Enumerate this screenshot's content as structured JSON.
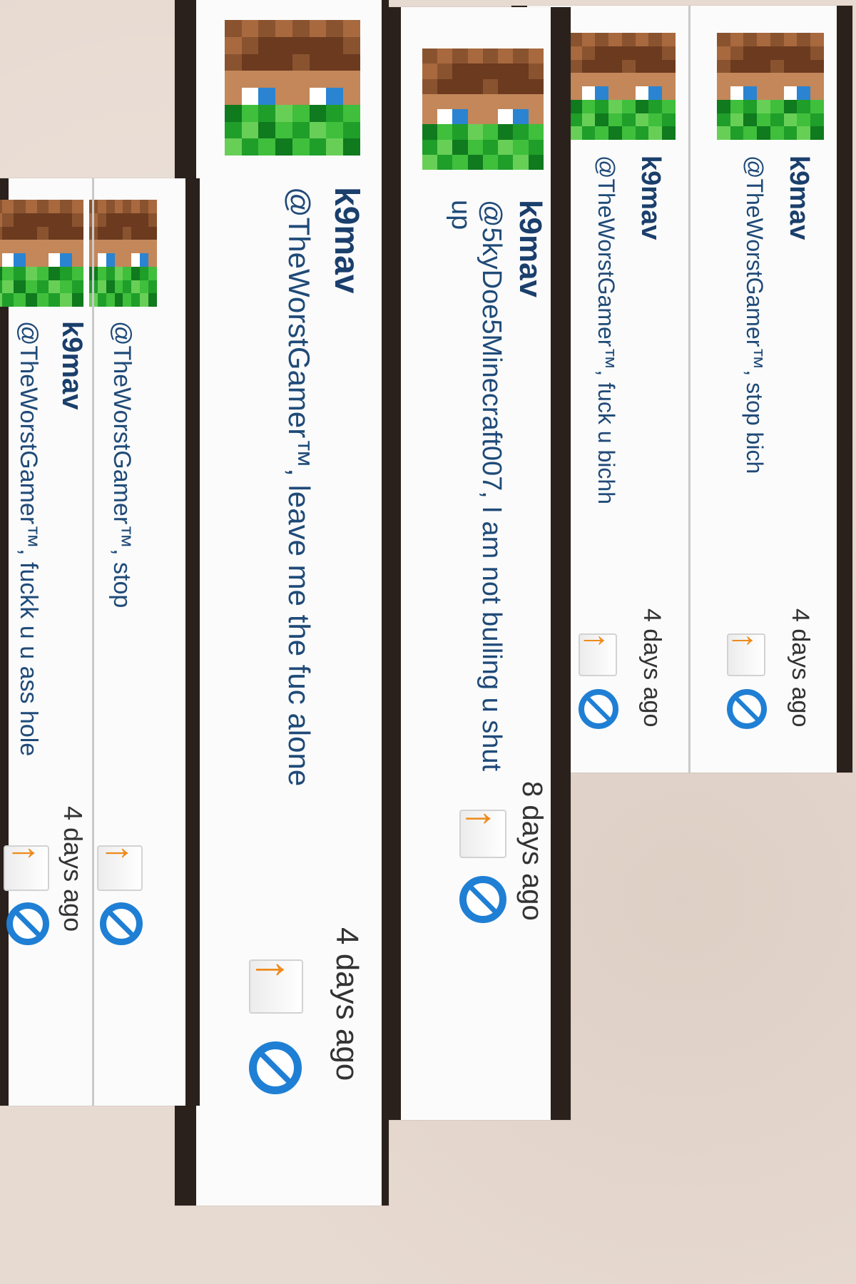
{
  "strips": [
    {
      "comments": [
        {
          "username": "k9mav",
          "message": "@TheWorstGamer™, stop bich",
          "timestamp": "4 days ago"
        },
        {
          "username": "k9mav",
          "message": "@TheWorstGamer™, fuck u bichh",
          "timestamp": "4 days ago"
        }
      ]
    },
    {
      "comments": [
        {
          "username": "k9mav",
          "message": "@5kyDoe5Minecraft007, I am not bulling u shut up",
          "timestamp": "8 days ago"
        }
      ]
    },
    {
      "comments": [
        {
          "username": "k9mav",
          "message": "@TheWorstGamer™, leave me the fuc alone",
          "timestamp": "4 days ago"
        }
      ]
    },
    {
      "comments": [
        {
          "username": "",
          "message": "@TheWorstGamer™, stop",
          "timestamp": ""
        },
        {
          "username": "k9mav",
          "message": "@TheWorstGamer™, fuckk u u ass hole",
          "timestamp": "4 days ago"
        }
      ]
    }
  ],
  "icons": {
    "avatar": "minecraft-creeper-skin-avatar",
    "reply": "reply-envelope-icon",
    "block": "block-icon"
  },
  "colors": {
    "username": "#1b3f6c",
    "message": "#1f4a78",
    "reply_arrow": "#ee8a1c",
    "block": "#1f7fd4",
    "band": "#2a211c",
    "background": "#e7dad1"
  }
}
